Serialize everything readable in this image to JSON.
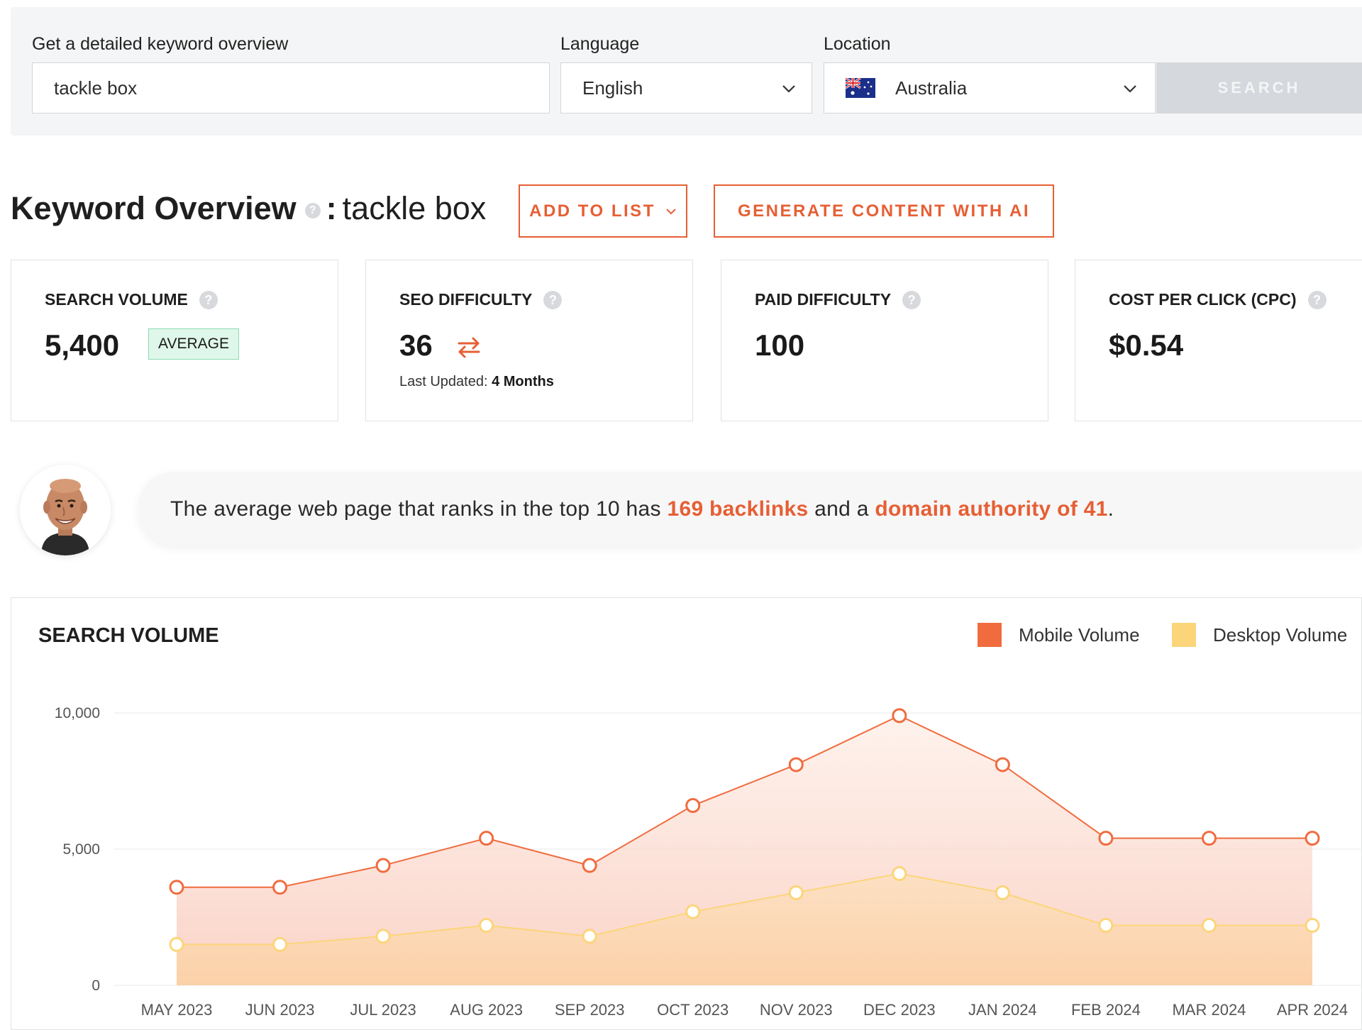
{
  "search": {
    "keyword_label": "Get a detailed keyword overview",
    "keyword_value": "tackle box",
    "language_label": "Language",
    "language_value": "English",
    "location_label": "Location",
    "location_value": "Australia",
    "search_button": "SEARCH"
  },
  "header": {
    "title": "Keyword Overview",
    "colon": ":",
    "keyword": "tackle box",
    "add_to_list": "ADD TO LIST",
    "generate": "GENERATE CONTENT WITH AI"
  },
  "metrics": {
    "search_volume": {
      "label": "SEARCH VOLUME",
      "value": "5,400",
      "badge": "AVERAGE"
    },
    "seo_difficulty": {
      "label": "SEO DIFFICULTY",
      "value": "36",
      "updated_prefix": "Last Updated:",
      "updated_value": "4 Months"
    },
    "paid_difficulty": {
      "label": "PAID DIFFICULTY",
      "value": "100"
    },
    "cpc": {
      "label": "COST PER CLICK (CPC)",
      "value": "$0.54"
    }
  },
  "insight": {
    "part1": "The average web page that ranks in the top 10 has ",
    "backlinks": "169 backlinks",
    "part2": " and a ",
    "authority": "domain authority of 41",
    "part3": "."
  },
  "colors": {
    "accent": "#e65f34",
    "mobile": "#f06c3f",
    "desktop": "#fcd57a",
    "badge_bg": "#dff7ea"
  },
  "chart_data": {
    "type": "area",
    "title": "SEARCH VOLUME",
    "categories": [
      "MAY 2023",
      "JUN 2023",
      "JUL 2023",
      "AUG 2023",
      "SEP 2023",
      "OCT 2023",
      "NOV 2023",
      "DEC 2023",
      "JAN 2024",
      "FEB 2024",
      "MAR 2024",
      "APR 2024"
    ],
    "series": [
      {
        "name": "Mobile Volume",
        "color": "#f06c3f",
        "values": [
          3600,
          3600,
          4400,
          5400,
          4400,
          6600,
          8100,
          9900,
          8100,
          5400,
          5400,
          5400
        ]
      },
      {
        "name": "Desktop Volume",
        "color": "#fcd57a",
        "values": [
          1500,
          1500,
          1800,
          2200,
          1800,
          2700,
          3400,
          4100,
          3400,
          2200,
          2200,
          2200
        ]
      }
    ],
    "yticks": [
      "0",
      "5,000",
      "10,000"
    ],
    "ylim": [
      0,
      10000
    ],
    "grid": true,
    "legend": "top-right"
  }
}
